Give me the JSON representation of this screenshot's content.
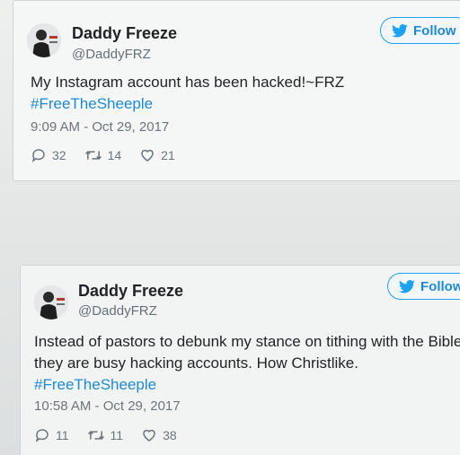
{
  "colors": {
    "accent": "#1da1f2",
    "link": "#1d8ad6",
    "name": "#1f2326",
    "muted": "#657178"
  },
  "tweets": [
    {
      "name": "Daddy Freeze",
      "handle": "@DaddyFRZ",
      "follow_label": "Follow",
      "text_lines": [
        "My Instagram account has been hacked!~FRZ"
      ],
      "hashtag": "#FreeTheSheeple",
      "timestamp": "9:09 AM - Oct 29, 2017",
      "reply_count": "32",
      "retweet_count": "14",
      "like_count": "21"
    },
    {
      "name": "Daddy Freeze",
      "handle": "@DaddyFRZ",
      "follow_label": "Follow",
      "text_lines": [
        "Instead of pastors to debunk my stance on tithing with the Bible,",
        "they are busy hacking accounts. How Christlike."
      ],
      "hashtag": "#FreeTheSheeple",
      "timestamp": "10:58 AM - Oct 29, 2017",
      "reply_count": "11",
      "retweet_count": "11",
      "like_count": "38"
    }
  ],
  "icons": {
    "follow": "twitter-bird-icon",
    "reply": "reply-icon",
    "retweet": "retweet-icon",
    "like": "heart-icon"
  }
}
